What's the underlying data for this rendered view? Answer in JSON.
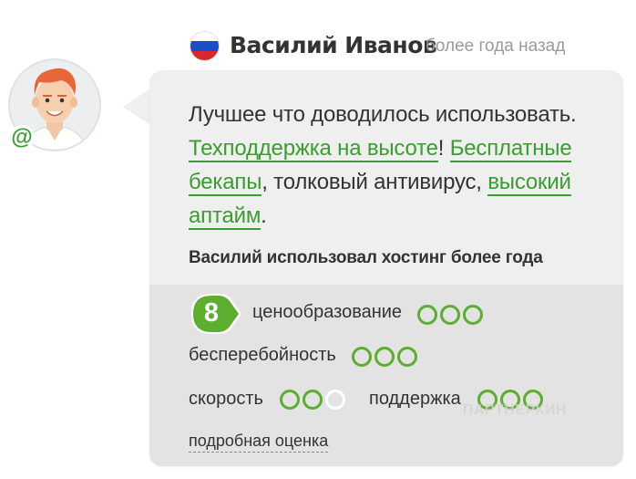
{
  "review": {
    "author": "Василий Иванов",
    "time": "более года назад",
    "text_p1": "Лучшее что доводилось использовать. ",
    "link_support": "Техподдержка на высоте",
    "text_p2": "! ",
    "link_backups": "Бесплатные бекапы",
    "text_p3": ", толковый антивирус, ",
    "link_uptime": "высокий аптайм",
    "text_p4": ".",
    "usage": "Василий использовал хостинг более года"
  },
  "rating": {
    "score": "8",
    "items": [
      {
        "label": "ценообразование",
        "filled": 3,
        "total": 3
      },
      {
        "label": "бесперебойность",
        "filled": 3,
        "total": 3
      },
      {
        "label": "скорость",
        "filled": 2,
        "total": 3
      },
      {
        "label": "поддержка",
        "filled": 3,
        "total": 3
      }
    ],
    "details_link": "подробная оценка"
  },
  "icons": {
    "avatar": "user-avatar",
    "flag": "russia-flag-icon",
    "email": "at-sign-icon"
  },
  "colors": {
    "accent_green": "#3a9d2f",
    "dot_green": "#5cae2e",
    "bubble_bg": "#efefef",
    "ratings_bg": "#e3e3e3",
    "muted_text": "#9a9a9a"
  },
  "watermark": "ПАРТНЕРКИН"
}
